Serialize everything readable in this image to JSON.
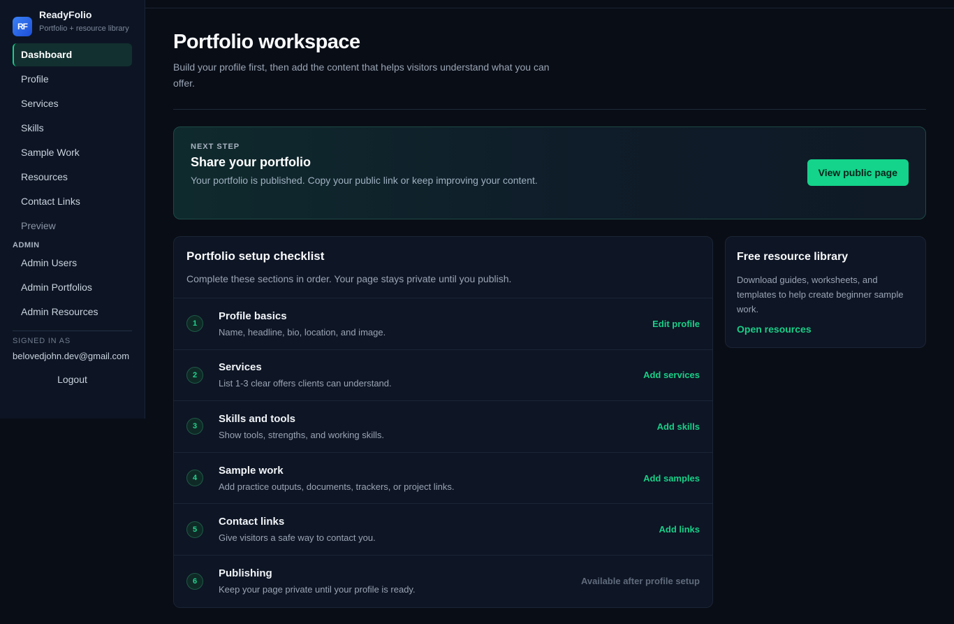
{
  "brand": {
    "logo_text": "RF",
    "name": "ReadyFolio",
    "subtitle": "Portfolio + resource library"
  },
  "sidebar": {
    "items": [
      {
        "label": "Dashboard",
        "active": true
      },
      {
        "label": "Profile"
      },
      {
        "label": "Services"
      },
      {
        "label": "Skills"
      },
      {
        "label": "Sample Work"
      },
      {
        "label": "Resources"
      },
      {
        "label": "Contact Links"
      },
      {
        "label": "Preview"
      }
    ],
    "admin_label": "ADMIN",
    "admin_items": [
      {
        "label": "Admin Users"
      },
      {
        "label": "Admin Portfolios"
      },
      {
        "label": "Admin Resources"
      }
    ],
    "signed_in_label": "SIGNED IN AS",
    "signed_in_email": "belovedjohn.dev@gmail.com",
    "logout_label": "Logout"
  },
  "header": {
    "title": "Portfolio workspace",
    "subtitle": "Build your profile first, then add the content that helps visitors understand what you can offer."
  },
  "next_step": {
    "label": "NEXT STEP",
    "title": "Share your portfolio",
    "text": "Your portfolio is published. Copy your public link or keep improving your content.",
    "button": "View public page"
  },
  "checklist": {
    "title": "Portfolio setup checklist",
    "subtitle": "Complete these sections in order. Your page stays private until you publish.",
    "steps": [
      {
        "num": "1",
        "title": "Profile basics",
        "desc": "Name, headline, bio, location, and image.",
        "action": "Edit profile"
      },
      {
        "num": "2",
        "title": "Services",
        "desc": "List 1-3 clear offers clients can understand.",
        "action": "Add services"
      },
      {
        "num": "3",
        "title": "Skills and tools",
        "desc": "Show tools, strengths, and working skills.",
        "action": "Add skills"
      },
      {
        "num": "4",
        "title": "Sample work",
        "desc": "Add practice outputs, documents, trackers, or project links.",
        "action": "Add samples"
      },
      {
        "num": "5",
        "title": "Contact links",
        "desc": "Give visitors a safe way to contact you.",
        "action": "Add links"
      },
      {
        "num": "6",
        "title": "Publishing",
        "desc": "Keep your page private until your profile is ready.",
        "action": "Available after profile setup"
      }
    ]
  },
  "resources": {
    "title": "Free resource library",
    "text": "Download guides, worksheets, and templates to help create beginner sample work.",
    "link": "Open resources"
  },
  "colors": {
    "accent": "#14d38a",
    "background": "#090d16",
    "sidebar": "#0d1524"
  }
}
